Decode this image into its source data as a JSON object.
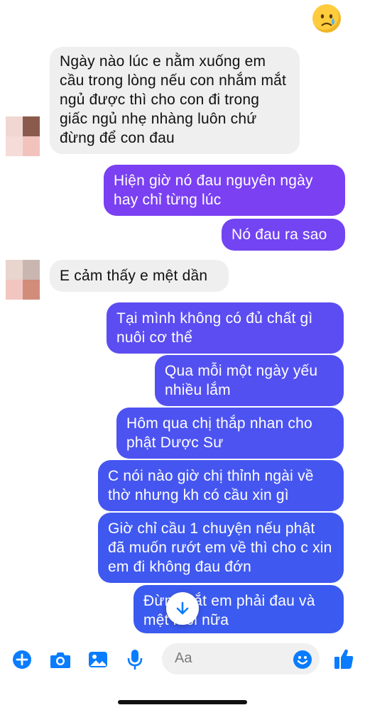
{
  "colors": {
    "accent": "#0a7cff",
    "bubble_in": "#efefef",
    "bubble_out_top": "#7b3ff2",
    "bubble_out_bottom": "#3c58f0"
  },
  "reaction": {
    "icon": "crying-face-emoji"
  },
  "messages": [
    {
      "side": "in",
      "text": "Ngày nào lúc e nằm xuống em cầu trong lòng nếu con nhắm mắt ngủ được thì cho con đi trong giấc ngủ nhẹ nhàng luôn chứ đừng để con đau"
    },
    {
      "side": "out",
      "text": "Hiện giờ nó đau nguyên ngày hay chỉ từng lúc"
    },
    {
      "side": "out",
      "text": "Nó đau ra sao"
    },
    {
      "side": "in",
      "text": "E cảm thấy e mệt dần"
    },
    {
      "side": "out",
      "text": "Tại mình không có đủ chất gì nuôi cơ thể"
    },
    {
      "side": "out",
      "text": "Qua mỗi một ngày yếu nhiều lắm"
    },
    {
      "side": "out",
      "text": "Hôm qua chị thắp nhan cho phật Dược Sư"
    },
    {
      "side": "out",
      "text": "C nói nào giờ chị thỉnh ngài về thờ nhưng kh có cầu xin gì"
    },
    {
      "side": "out",
      "text": "Giờ chỉ cầu 1 chuyện nếu phật đã muốn rướt em về thì cho c xin em đi không đau đớn"
    },
    {
      "side": "out",
      "text": "Đừng bắt em phải đau và mệt mỏi nữa"
    }
  ],
  "composer": {
    "placeholder": "Aa",
    "icons": [
      "plus-icon",
      "camera-icon",
      "image-icon",
      "microphone-icon",
      "emoji-icon",
      "thumbs-up-icon"
    ]
  },
  "scroll_button": {
    "icon": "arrow-down-icon"
  }
}
